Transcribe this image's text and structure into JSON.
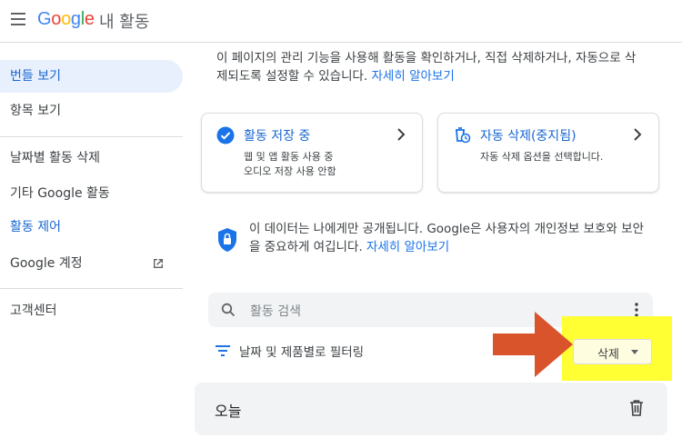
{
  "header": {
    "logo_letters": [
      {
        "ch": "G",
        "color": "#4285F4"
      },
      {
        "ch": "o",
        "color": "#EA4335"
      },
      {
        "ch": "o",
        "color": "#FBBC05"
      },
      {
        "ch": "g",
        "color": "#4285F4"
      },
      {
        "ch": "l",
        "color": "#34A853"
      },
      {
        "ch": "e",
        "color": "#EA4335"
      }
    ],
    "title": "내 활동"
  },
  "sidebar": {
    "items": [
      {
        "label": "번들 보기"
      },
      {
        "label": "항목 보기"
      },
      {
        "label": "날짜별 활동 삭제"
      },
      {
        "label": "기타 Google 활동"
      },
      {
        "label": "활동 제어"
      },
      {
        "label": "Google 계정"
      },
      {
        "label": "고객센터"
      }
    ]
  },
  "main": {
    "intro_text": "이 페이지의 관리 기능을 사용해 활동을 확인하거나, 직접 삭제하거나, 자동으로 삭제되도록 설정할 수 있습니다.",
    "intro_link": "자세히 알아보기",
    "card_saving": {
      "title": "활동 저장 중",
      "line1": "웹 및 앱 활동 사용 중",
      "line2": "오디오 저장 사용 안함"
    },
    "card_auto_delete": {
      "title": "자동 삭제(중지됨)",
      "desc": "자동 삭제 옵션을 선택합니다."
    },
    "privacy_text": "이 데이터는 나에게만 공개됩니다. Google은 사용자의 개인정보 보호와 보안을 중요하게 여깁니다.",
    "privacy_link": "자세히 알아보기",
    "search_placeholder": "활동 검색",
    "filter_label": "날짜 및 제품별로 필터링",
    "delete_label": "삭제",
    "today_label": "오늘"
  },
  "colors": {
    "accent": "#1a73e8",
    "highlight": "#ffff33",
    "arrow": "#d9542b"
  }
}
